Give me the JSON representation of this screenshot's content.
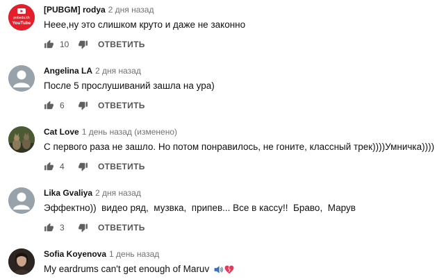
{
  "comments": [
    {
      "author": "[PUBGM] rodya",
      "time": "2 дня назад",
      "text": "Неее,ну это слишком круто и даже не законно",
      "likes": "10",
      "reply_label": "ОТВЕТИТЬ",
      "avatar_text": [
        "pobeda.kh",
        "YouTube"
      ]
    },
    {
      "author": "Angelina LA",
      "time": "2 дня назад",
      "text": "После 5 прослушиваний зашла на ура)",
      "likes": "6",
      "reply_label": "ОТВЕТИТЬ"
    },
    {
      "author": "Cat Love",
      "time": "1 день назад (изменено)",
      "text": "С первого раза не зашло. Но потом понравилось, не гоните, классный трек))))Умничка))))",
      "likes": "4",
      "reply_label": "ОТВЕТИТЬ"
    },
    {
      "author": "Lika Gvaliya",
      "time": "2 дня назад",
      "text": "Эффектно))  видео ряд,  музвка,  припев... Все в кассу!!  Браво,  Марув",
      "likes": "3",
      "reply_label": "ОТВЕТИТЬ"
    },
    {
      "author": "Sofia Koyenova",
      "time": "1 день назад",
      "text": "My eardrums can't get enough of Maruv",
      "emojis": [
        "speaker-icon",
        "heart-icon"
      ]
    }
  ],
  "colors": {
    "secondary": "#717171",
    "icon": "#606060",
    "youtube_red": "#e62117"
  }
}
